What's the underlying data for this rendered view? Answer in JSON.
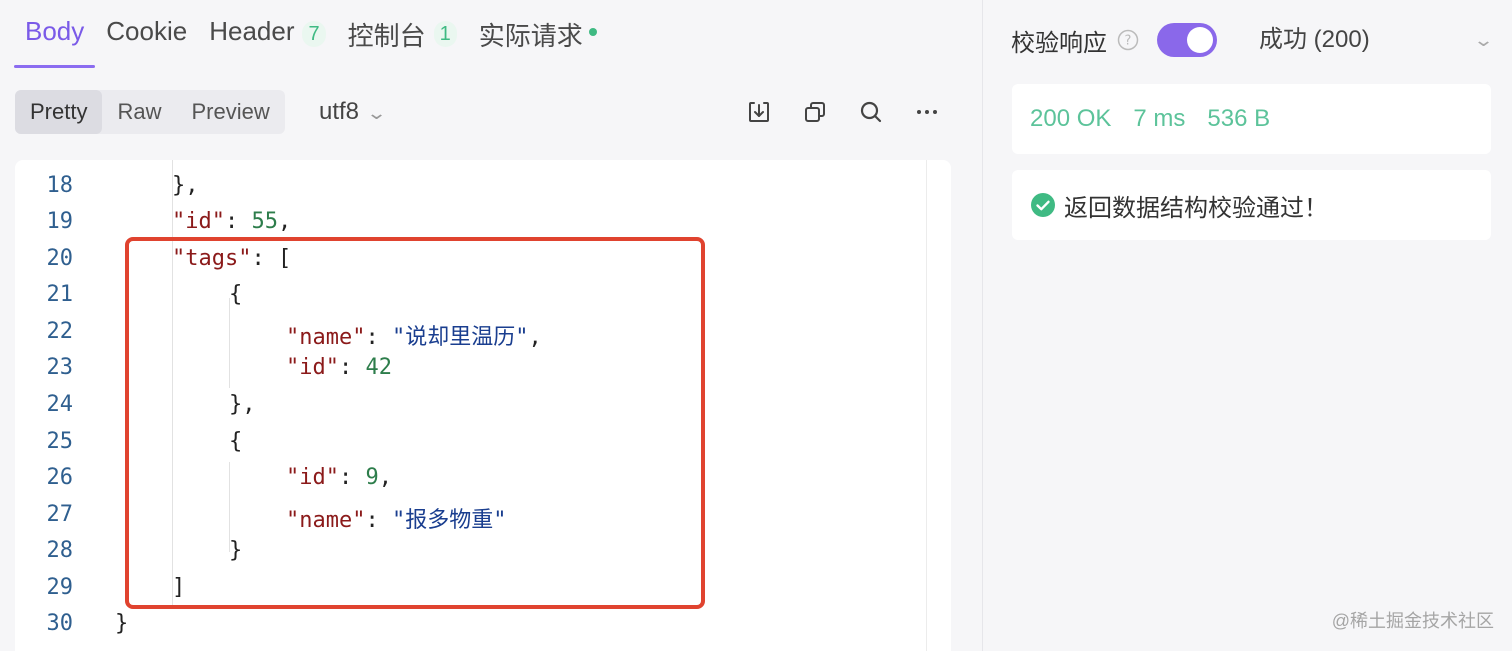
{
  "tabs": [
    {
      "label": "Body",
      "active": true
    },
    {
      "label": "Cookie"
    },
    {
      "label": "Header",
      "count": "7"
    },
    {
      "label": "控制台",
      "count": "1"
    },
    {
      "label": "实际请求",
      "dot": true
    }
  ],
  "toolbar": {
    "view_modes": [
      "Pretty",
      "Raw",
      "Preview"
    ],
    "selected_view": "Pretty",
    "encoding": "utf8",
    "icons": [
      "download-icon",
      "copy-icon",
      "search-icon",
      "more-icon"
    ]
  },
  "code": {
    "line_numbers": [
      "18",
      "19",
      "20",
      "21",
      "22",
      "23",
      "24",
      "25",
      "26",
      "27",
      "28",
      "29",
      "30"
    ],
    "lines": [
      {
        "text": "},"
      },
      {
        "key": "\"id\"",
        "sep": ": ",
        "num": "55",
        "end": ","
      },
      {
        "key": "\"tags\"",
        "sep": ": ",
        "end": "["
      },
      {
        "text": "{"
      },
      {
        "key": "\"name\"",
        "sep": ": ",
        "str": "\"说却里温历\"",
        "end": ","
      },
      {
        "key": "\"id\"",
        "sep": ": ",
        "num": "42",
        "end": ""
      },
      {
        "text": "},"
      },
      {
        "text": "{"
      },
      {
        "key": "\"id\"",
        "sep": ": ",
        "num": "9",
        "end": ","
      },
      {
        "key": "\"name\"",
        "sep": ": ",
        "str": "\"报多物重\"",
        "end": ""
      },
      {
        "text": "}"
      },
      {
        "text": "]"
      },
      {
        "text": "}"
      }
    ]
  },
  "validation": {
    "label": "校验响应",
    "enabled": true,
    "status": "成功 (200)"
  },
  "metrics": {
    "status": "200 OK",
    "time": "7 ms",
    "size": "536 B"
  },
  "result": {
    "message": "返回数据结构校验通过！"
  },
  "watermark": "@稀土掘金技术社区",
  "colors": {
    "accent": "#8a68ea",
    "success": "#3fba83",
    "highlight": "#e0432f"
  }
}
